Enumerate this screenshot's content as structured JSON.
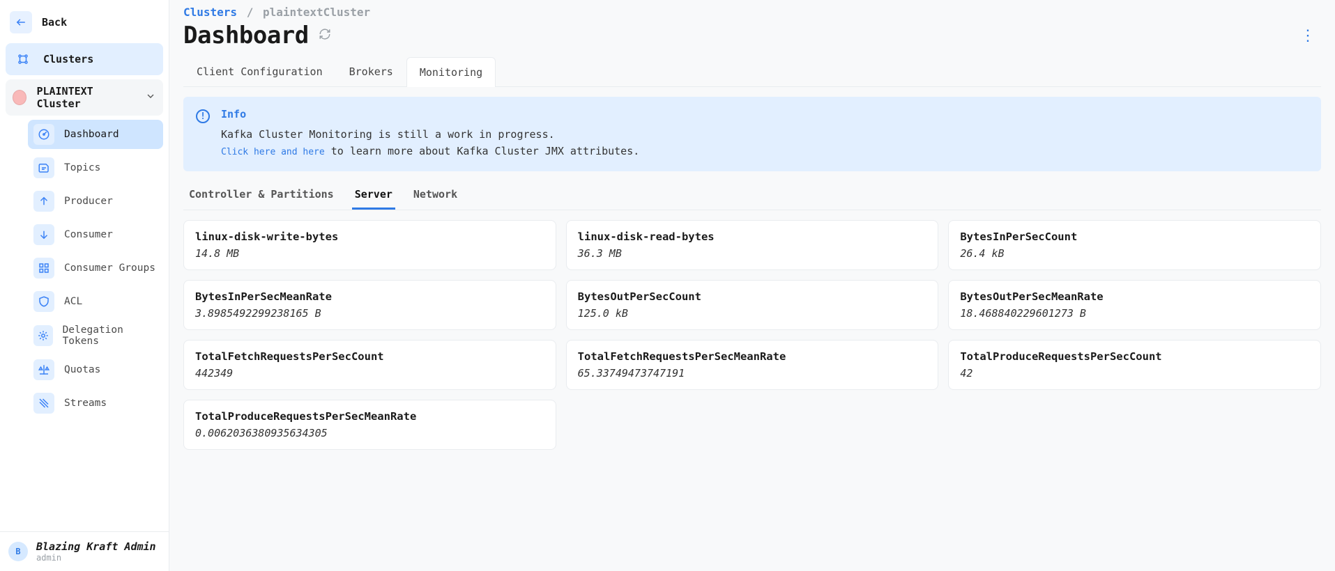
{
  "sidebar": {
    "back_label": "Back",
    "clusters_label": "Clusters",
    "cluster_name": "PLAINTEXT Cluster",
    "items": [
      {
        "label": "Dashboard"
      },
      {
        "label": "Topics"
      },
      {
        "label": "Producer"
      },
      {
        "label": "Consumer"
      },
      {
        "label": "Consumer Groups"
      },
      {
        "label": "ACL"
      },
      {
        "label": "Delegation Tokens"
      },
      {
        "label": "Quotas"
      },
      {
        "label": "Streams"
      }
    ]
  },
  "user": {
    "name": "Blazing Kraft Admin",
    "role": "admin",
    "initial": "B"
  },
  "breadcrumb": {
    "root": "Clusters",
    "current": "plaintextCluster"
  },
  "page_title": "Dashboard",
  "tabs": [
    {
      "label": "Client Configuration"
    },
    {
      "label": "Brokers"
    },
    {
      "label": "Monitoring"
    }
  ],
  "active_tab": 2,
  "info": {
    "title": "Info",
    "line1": "Kafka Cluster Monitoring is still a work in progress.",
    "link_text": "Click here and here",
    "line2_rest": " to learn more about Kafka Cluster JMX attributes."
  },
  "subtabs": [
    {
      "label": "Controller & Partitions"
    },
    {
      "label": "Server"
    },
    {
      "label": "Network"
    }
  ],
  "active_subtab": 1,
  "cards": [
    {
      "title": "linux-disk-write-bytes",
      "value": "14.8 MB"
    },
    {
      "title": "linux-disk-read-bytes",
      "value": "36.3 MB"
    },
    {
      "title": "BytesInPerSecCount",
      "value": "26.4 kB"
    },
    {
      "title": "BytesInPerSecMeanRate",
      "value": "3.8985492299238165 B"
    },
    {
      "title": "BytesOutPerSecCount",
      "value": "125.0 kB"
    },
    {
      "title": "BytesOutPerSecMeanRate",
      "value": "18.468840229601273 B"
    },
    {
      "title": "TotalFetchRequestsPerSecCount",
      "value": "442349"
    },
    {
      "title": "TotalFetchRequestsPerSecMeanRate",
      "value": "65.33749473747191"
    },
    {
      "title": "TotalProduceRequestsPerSecCount",
      "value": "42"
    },
    {
      "title": "TotalProduceRequestsPerSecMeanRate",
      "value": "0.0062036380935634305"
    }
  ]
}
